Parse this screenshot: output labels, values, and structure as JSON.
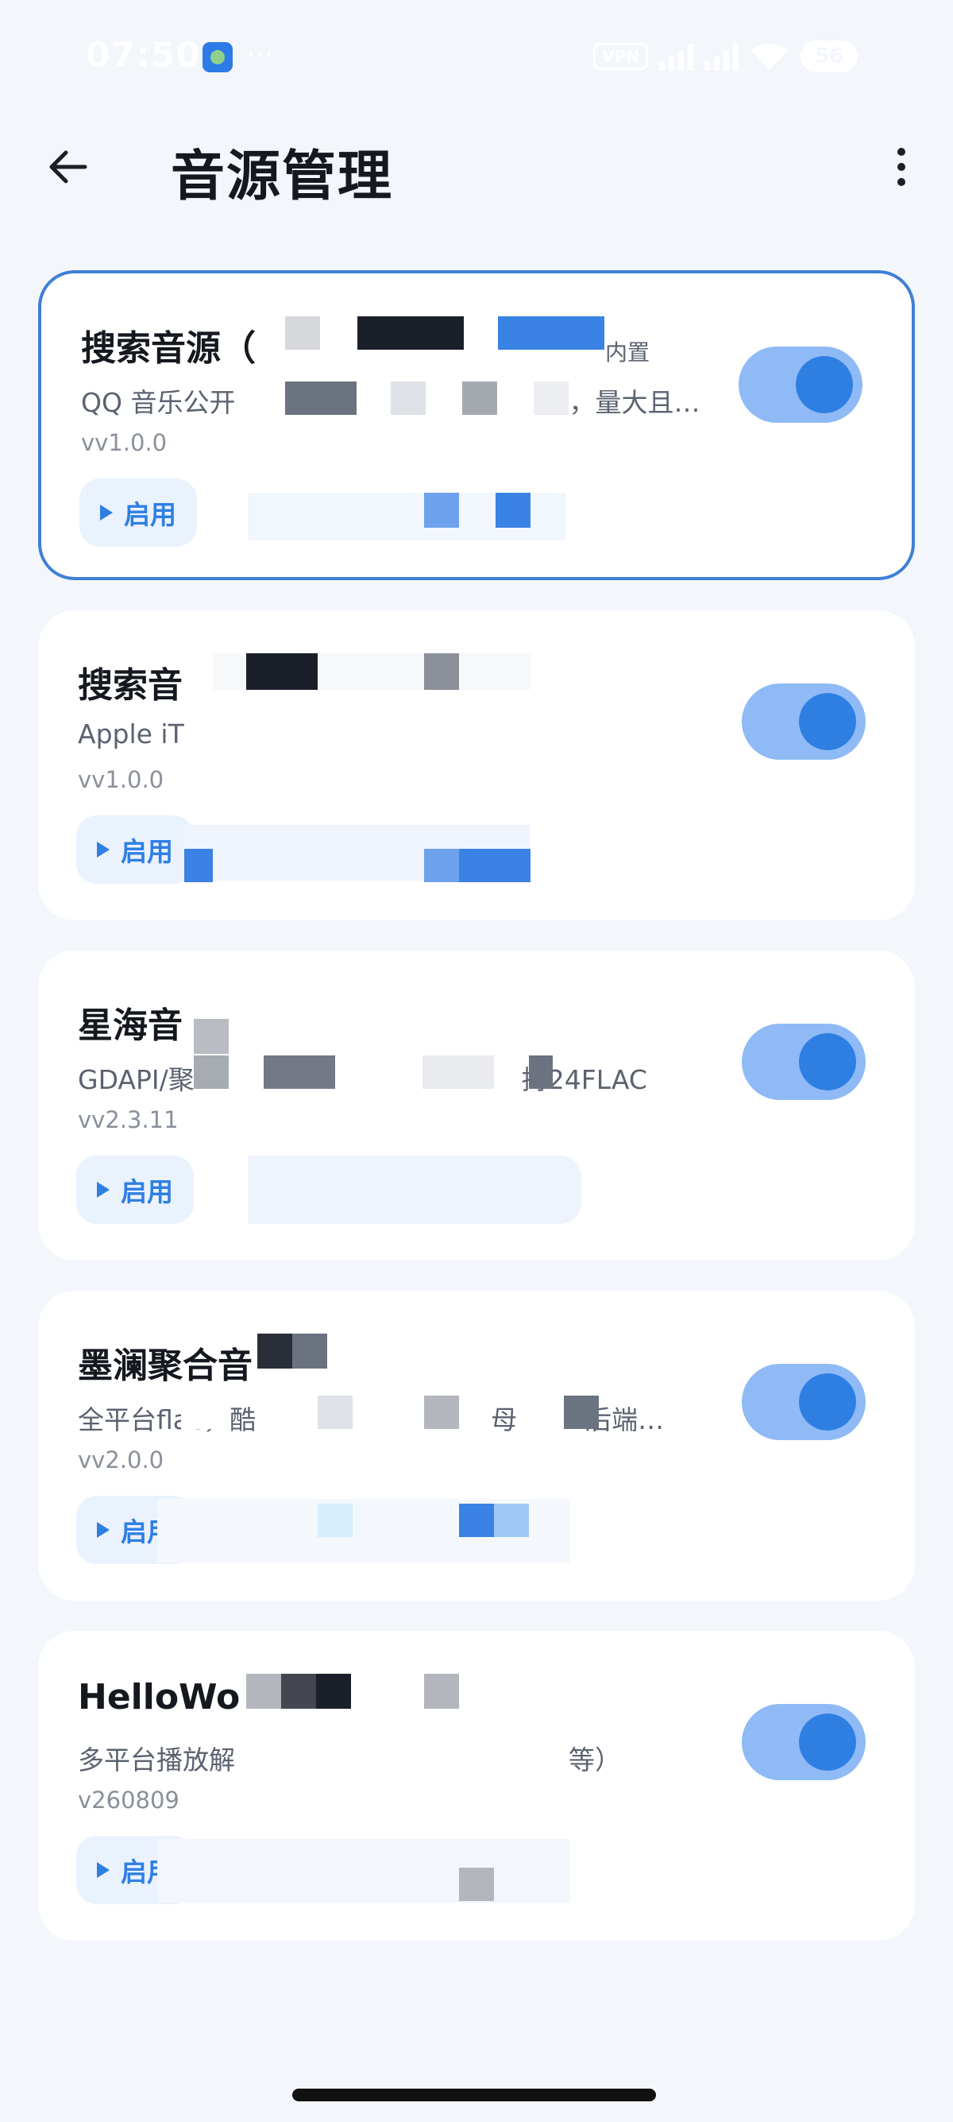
{
  "status_bar": {
    "time": "07:50",
    "dots": "···",
    "vpn": "VPN",
    "battery": "56"
  },
  "app_bar": {
    "title": "音源管理"
  },
  "enable_label": "启用",
  "colors": {
    "accent": "#2f7fe3",
    "toggle_track": "#8fbaf5",
    "enable_bg": "#eaf2fd",
    "card_border_selected": "#3f7fd6",
    "page_bg": "#f3f6fb"
  },
  "sources": [
    {
      "title": "搜索音源（",
      "title_tail": "内置",
      "desc": "QQ 音乐公开",
      "desc_tail": "，量大且…",
      "version": "vv1.0.0",
      "enabled": true,
      "selected": true
    },
    {
      "title": "搜索音",
      "desc": "Apple iT",
      "version": "vv1.0.0",
      "enabled": true,
      "selected": false
    },
    {
      "title": "星海音",
      "desc": "GDAPI/聚",
      "desc_tail": "持24FLAC",
      "version": "vv2.3.11",
      "enabled": true,
      "selected": false
    },
    {
      "title": "墨澜聚合音",
      "desc": "全平台flac，酷",
      "desc_mid": "母",
      "desc_tail": "后端…",
      "version": "vv2.0.0",
      "enabled": true,
      "selected": false
    },
    {
      "title": "HelloWo",
      "desc": "多平台播放解",
      "desc_tail": "等）",
      "version": "v260809",
      "enabled": true,
      "selected": false
    }
  ]
}
